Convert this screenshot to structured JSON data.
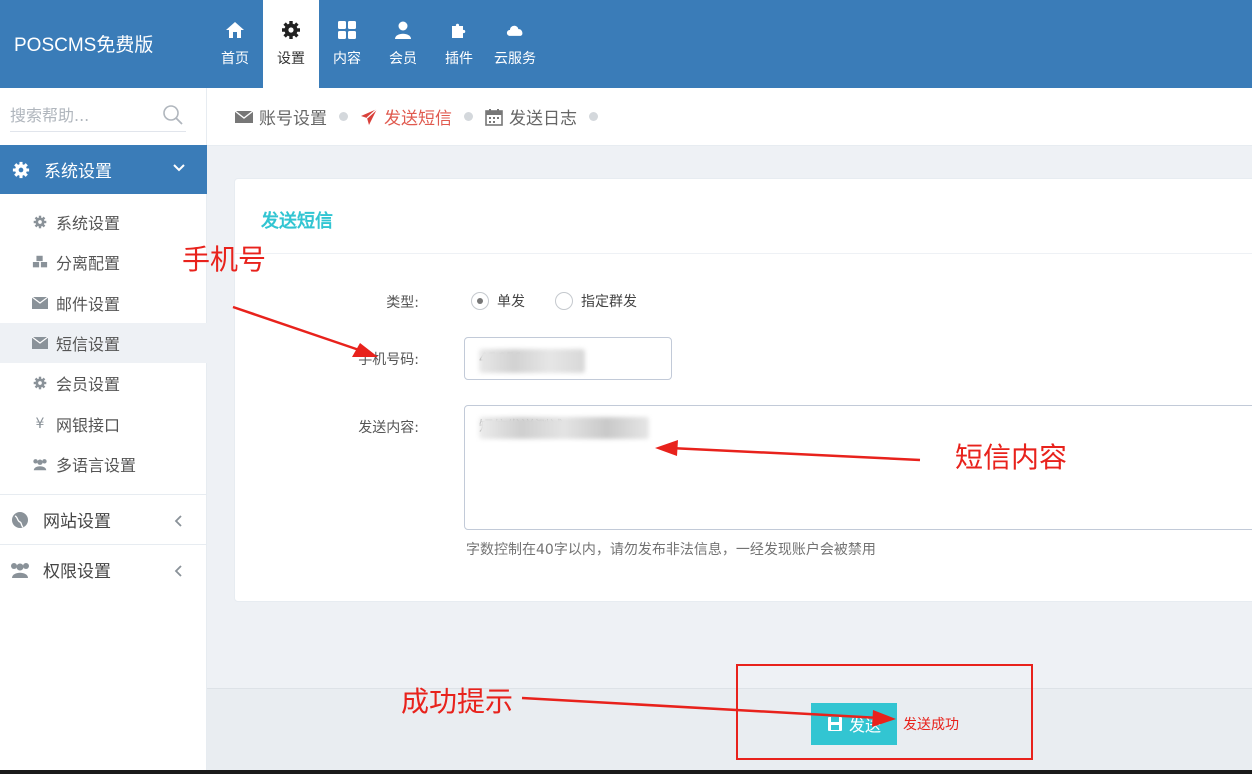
{
  "header": {
    "brand": "POSCMS免费版",
    "nav": [
      {
        "label": "首页",
        "icon": "home-icon"
      },
      {
        "label": "设置",
        "icon": "gear-icon"
      },
      {
        "label": "内容",
        "icon": "grid-icon"
      },
      {
        "label": "会员",
        "icon": "user-icon"
      },
      {
        "label": "插件",
        "icon": "puzzle-icon"
      },
      {
        "label": "云服务",
        "icon": "cloud-icon"
      }
    ]
  },
  "sidebar": {
    "search_placeholder": "搜索帮助...",
    "section_title": "系统设置",
    "items": [
      {
        "label": "系统设置",
        "icon": "gear-icon"
      },
      {
        "label": "分离配置",
        "icon": "cubes-icon"
      },
      {
        "label": "邮件设置",
        "icon": "envelope-icon"
      },
      {
        "label": "短信设置",
        "icon": "envelope-icon"
      },
      {
        "label": "会员设置",
        "icon": "gear-icon"
      },
      {
        "label": "网银接口",
        "icon": "yen-icon"
      },
      {
        "label": "多语言设置",
        "icon": "users-icon"
      }
    ],
    "groups": [
      {
        "label": "网站设置",
        "icon": "globe-icon"
      },
      {
        "label": "权限设置",
        "icon": "users-icon"
      }
    ]
  },
  "tabs": [
    {
      "label": "账号设置",
      "icon": "envelope-icon"
    },
    {
      "label": "发送短信",
      "icon": "paper-plane-icon"
    },
    {
      "label": "发送日志",
      "icon": "calendar-icon"
    }
  ],
  "form": {
    "title": "发送短信",
    "type_label": "类型:",
    "type_options": [
      "单发",
      "指定群发"
    ],
    "phone_label": "手机号码:",
    "phone_value": "45651",
    "content_label": "发送内容:",
    "content_value": "短信发送测试",
    "help_text": "字数控制在40字以内，请勿发布非法信息，一经发现账户会被禁用"
  },
  "footer": {
    "send_label": "发送",
    "success_text": "发送成功"
  },
  "annotations": {
    "phone": "手机号",
    "content": "短信内容",
    "success": "成功提示"
  },
  "colors": {
    "header_bg": "#3a7cb8",
    "accent_cyan": "#32c5d2",
    "active_tab_red": "#e05a4f",
    "annotation_red": "#e8221c"
  }
}
